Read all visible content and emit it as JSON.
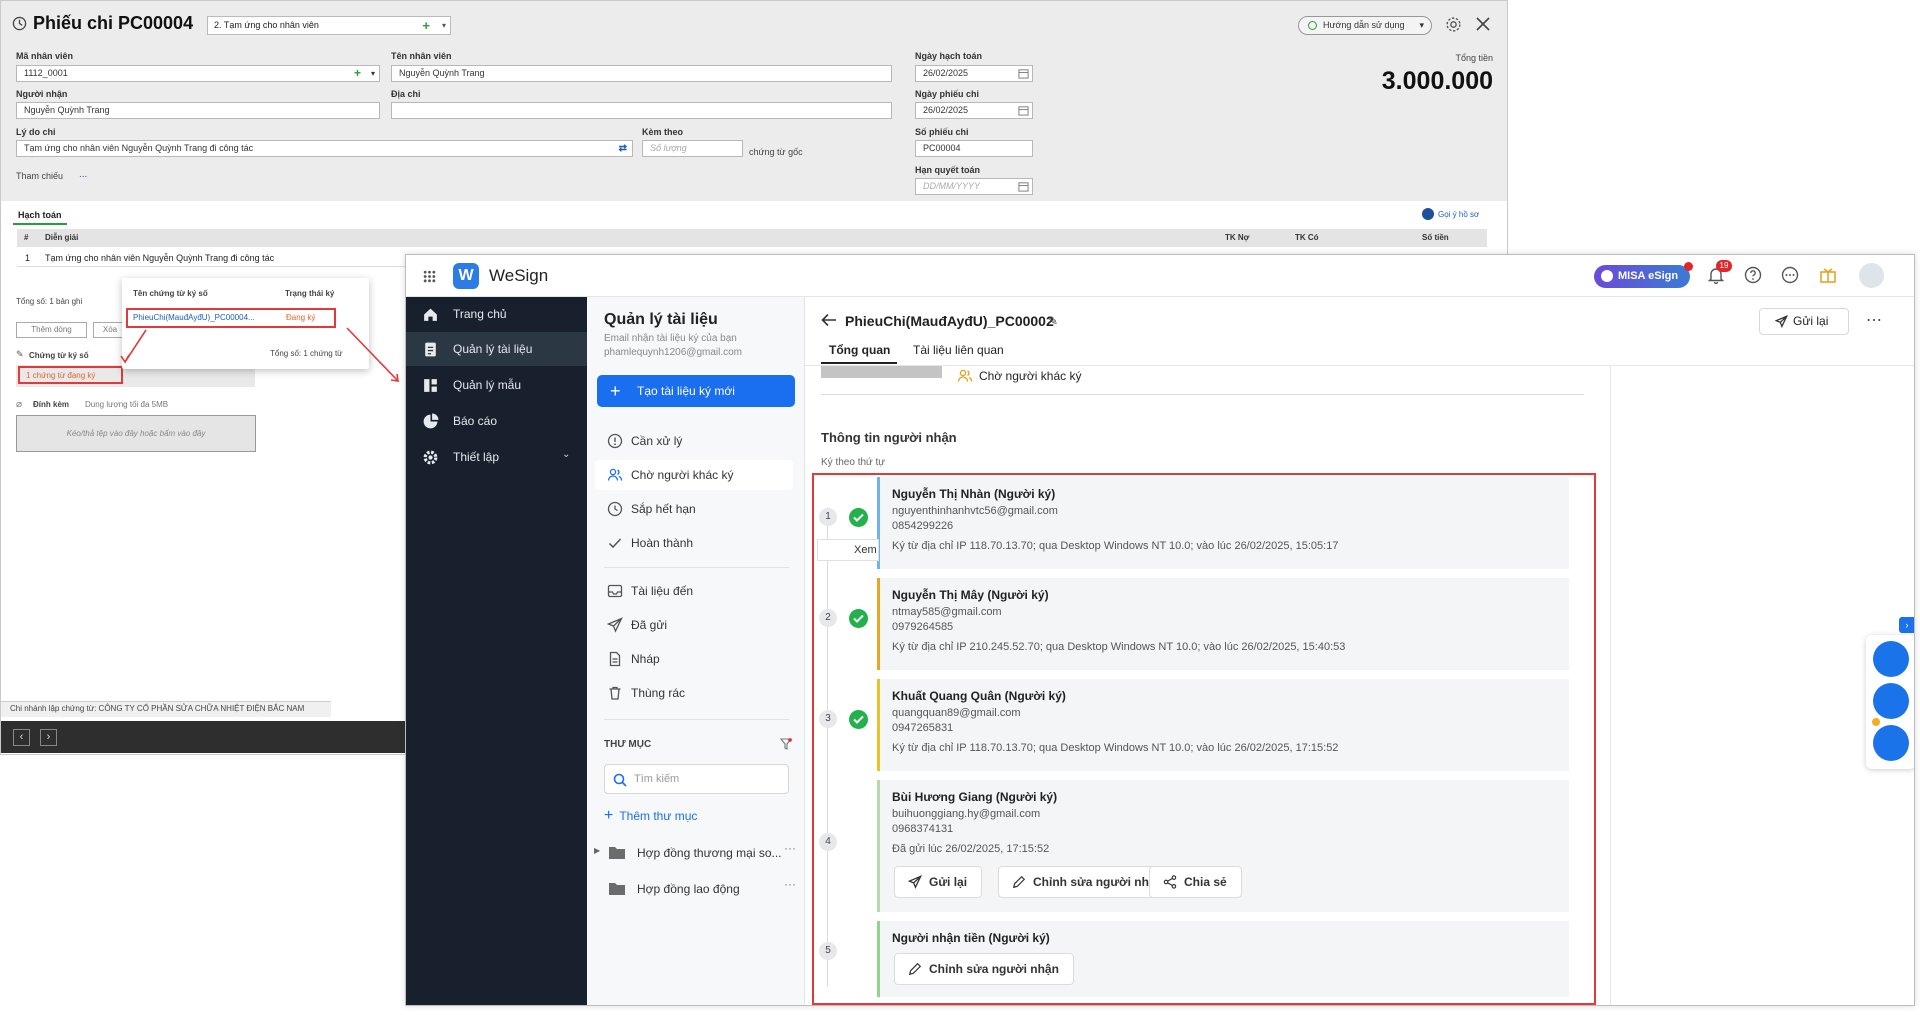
{
  "misa": {
    "title": "Phiếu chi PC00004",
    "reason_select": "2. Tạm ứng cho nhân viên",
    "help": "Hướng dẫn sử dụng",
    "labels": {
      "emp_code": "Mã nhân viên",
      "emp_name": "Tên nhân viên",
      "receiver": "Người nhận",
      "address": "Địa chỉ",
      "reason": "Lý do chi",
      "attach": "Kèm theo",
      "attach_unit": "chứng từ gốc",
      "ref": "Tham chiếu",
      "ref_dots": "...",
      "accounting_date": "Ngày hạch toán",
      "voucher_date": "Ngày phiếu chi",
      "voucher_no": "Số phiếu chi",
      "deadline": "Hạn quyết toán",
      "total": "Tổng tiền"
    },
    "values": {
      "emp_code": "1112_0001",
      "emp_name": "Nguyễn Quỳnh Trang",
      "receiver": "Nguyễn Quỳnh Trang",
      "address": "",
      "reason": "Tạm ứng cho nhân viên Nguyễn Quỳnh Trang đi công tác",
      "attach_placeholder": "Số lượng",
      "accounting_date": "26/02/2025",
      "voucher_date": "26/02/2025",
      "voucher_no": "PC00004",
      "deadline_placeholder": "DD/MM/YYYY",
      "total": "3.000.000"
    },
    "accounting_tab": "Hạch toán",
    "recall": "Gọi ý hồ sơ",
    "grid_headers": {
      "num": "#",
      "desc": "Diễn giải",
      "debit": "TK Nợ",
      "credit": "TK Có",
      "amount": "Số tiền"
    },
    "grid_row": {
      "num": "1",
      "desc": "Tạm ứng cho nhân viên Nguyễn Quỳnh Trang đi công tác"
    },
    "total_rows": "Tổng số: 1 bản ghi",
    "add_row": "Thêm dòng",
    "delete_row": "Xóa",
    "signed_docs_label": "Chứng từ ký số",
    "signing_badge": "1 chứng từ đang ký",
    "attach_label": "Đính kèm",
    "attach_limit": "Dung lượng tối đa 5MB",
    "dropzone": "Kéo/thả tệp vào đây hoặc bấm vào đây",
    "branch": "Chi nhánh lập chứng từ: CÔNG TY CỔ PHẦN SỬA CHỮA NHIỆT ĐIỆN BẮC NAM",
    "popup": {
      "col_name": "Tên chứng từ ký số",
      "col_status": "Trạng thái ký",
      "doc_name": "PhieuChi(MauđAyđU)_PC00004...",
      "doc_status": "Đang ký",
      "total": "Tổng số: 1 chứng từ"
    }
  },
  "wesign": {
    "app_name": "WeSign",
    "misa_esign": "MISA eSign",
    "notif_count": "19",
    "sidebar": [
      {
        "label": "Trang chủ",
        "icon": "home-icon"
      },
      {
        "label": "Quản lý tài liệu",
        "icon": "document-icon"
      },
      {
        "label": "Quản lý mẫu",
        "icon": "template-icon"
      },
      {
        "label": "Báo cáo",
        "icon": "report-icon"
      },
      {
        "label": "Thiết lập",
        "icon": "settings-icon"
      }
    ],
    "panel": {
      "title": "Quản lý tài liệu",
      "subtitle1": "Email nhận tài liệu ký của bạn",
      "email": "phamlequynh1206@gmail.com",
      "create_button": "Tạo tài liệu ký mới",
      "items": [
        "Cần xử lý",
        "Chờ người khác ký",
        "Sắp hết hạn",
        "Hoàn thành",
        "Tài liệu đến",
        "Đã gửi",
        "Nháp",
        "Thùng rác"
      ],
      "folder_header": "THƯ MỤC",
      "search_placeholder": "Tìm kiếm",
      "add_folder": "Thêm thư mục",
      "folders": [
        "Hợp đồng thương mại so...",
        "Hợp đồng lao động"
      ]
    },
    "doc": {
      "title": "PhieuChi(MauđAyđU)_PC00002",
      "resend": "Gửi lại",
      "tabs": [
        "Tổng quan",
        "Tài liệu liên quan"
      ],
      "status": "Chờ người khác ký",
      "section_title": "Thông tin người nhận",
      "order_label": "Ký theo thứ tự",
      "view_hint": "Xem"
    },
    "recipients": [
      {
        "step": "1",
        "name": "Nguyễn Thị Nhàn (Người ký)",
        "email": "nguyenthinhanhvtc56@gmail.com",
        "phone": "0854299226",
        "note": "Ký từ địa chỉ IP 118.70.13.70; qua Desktop Windows NT 10.0; vào lúc 26/02/2025, 15:05:17"
      },
      {
        "step": "2",
        "name": "Nguyễn Thị Mây (Người ký)",
        "email": "ntmay585@gmail.com",
        "phone": "0979264585",
        "note": "Ký từ địa chỉ IP 210.245.52.70; qua Desktop Windows NT 10.0; vào lúc 26/02/2025, 15:40:53"
      },
      {
        "step": "3",
        "name": "Khuất Quang Quân (Người ký)",
        "email": "quangquan89@gmail.com",
        "phone": "0947265831",
        "note": "Ký từ địa chỉ IP 118.70.13.70; qua Desktop Windows NT 10.0; vào lúc 26/02/2025, 17:15:52"
      },
      {
        "step": "4",
        "name": "Bùi Hương Giang (Người ký)",
        "email": "buihuonggiang.hy@gmail.com",
        "phone": "0968374131",
        "note": "Đã gửi lúc 26/02/2025, 17:15:52"
      },
      {
        "step": "5",
        "name": "Người nhận tiền (Người ký)",
        "email": "",
        "phone": "",
        "note": ""
      }
    ],
    "actions": {
      "resend": "Gửi lại",
      "edit": "Chỉnh sửa người nhận",
      "share": "Chia sẻ"
    },
    "colors": {
      "sidebar": "#17202c",
      "accent": "#1a73e8",
      "success": "#22b14c",
      "highlight": "#e03a3a"
    }
  }
}
